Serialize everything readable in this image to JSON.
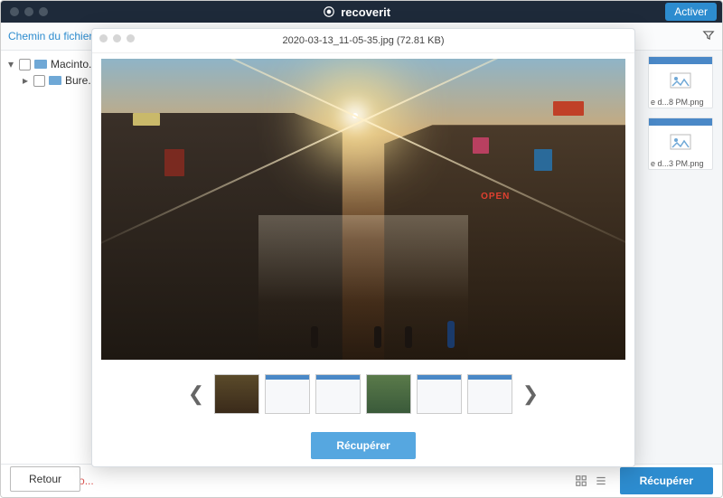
{
  "app": {
    "name": "recoverit"
  },
  "header": {
    "activate": "Activer"
  },
  "toolbar": {
    "path_label": "Chemin du fichier"
  },
  "sidebar": {
    "items": [
      {
        "label": "Macinto..."
      },
      {
        "label": "Bure..."
      }
    ]
  },
  "files": [
    {
      "label": "e d...8 PM.png"
    },
    {
      "label": "e d...3 PM.png"
    }
  ],
  "footer": {
    "recovering": "Récupératio...",
    "back": "Retour",
    "recover": "Récupérer"
  },
  "preview": {
    "title": "2020-03-13_11-05-35.jpg (72.81 KB)",
    "open_sign": "OPEN",
    "recover": "Récupérer"
  }
}
